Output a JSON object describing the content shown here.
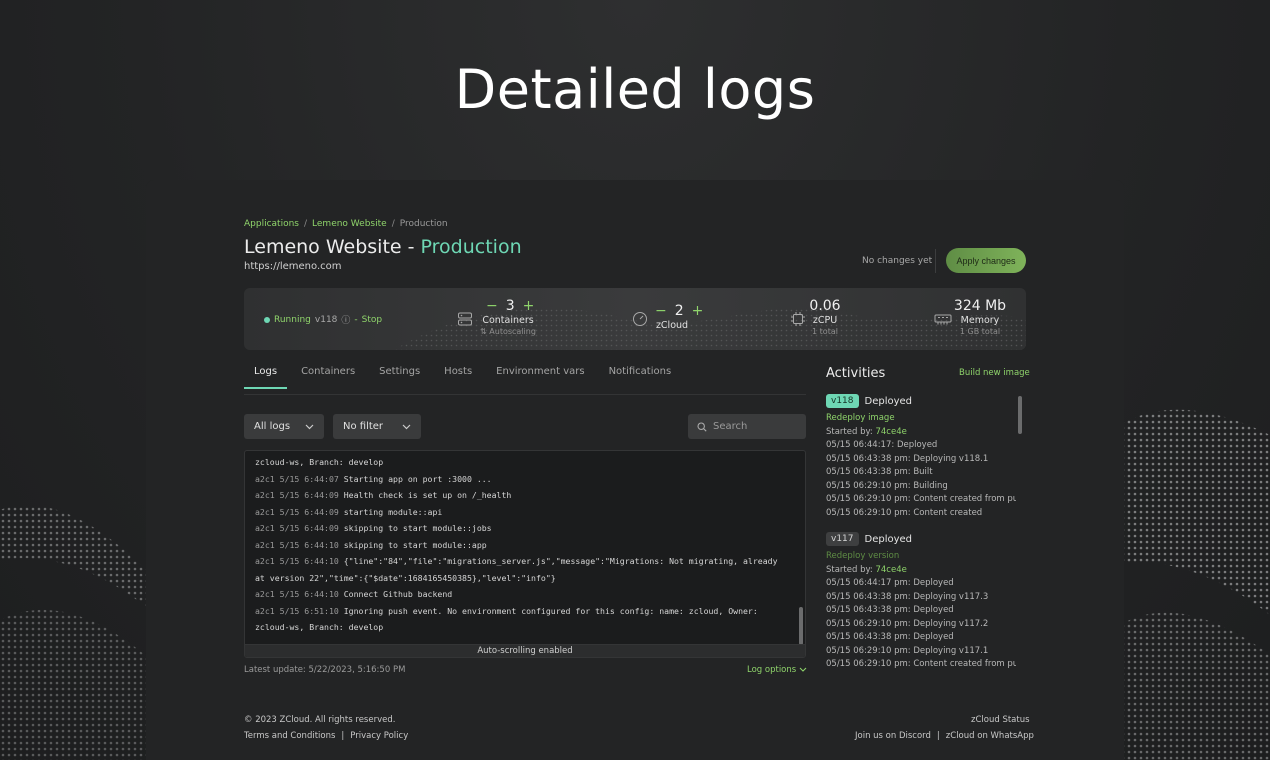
{
  "hero": {
    "title": "Detailed logs"
  },
  "breadcrumb": {
    "items": [
      "Applications",
      "Lemeno Website",
      "Production"
    ]
  },
  "header": {
    "app_name": "Lemeno Website - ",
    "environment": "Production",
    "url": "https://lemeno.com",
    "no_changes": "No changes yet",
    "apply_label": "Apply changes"
  },
  "stats": {
    "status": {
      "state": "Running",
      "version": "v118",
      "separator": "-",
      "action": "Stop"
    },
    "containers": {
      "value": "3",
      "label": "Containers",
      "sub": "⇅ Autoscaling"
    },
    "zcloud": {
      "value": "2",
      "label": "zCloud"
    },
    "zcpu": {
      "value": "0.06",
      "label": "zCPU",
      "sub": "1 total"
    },
    "memory": {
      "value": "324 Mb",
      "label": "Memory",
      "sub": "1 GB total"
    }
  },
  "tabs": [
    "Logs",
    "Containers",
    "Settings",
    "Hosts",
    "Environment vars",
    "Notifications"
  ],
  "filters": {
    "logs": "All logs",
    "filter": "No filter",
    "search_placeholder": "Search"
  },
  "logs": {
    "lines": [
      {
        "meta": "",
        "text": "zcloud-ws, Branch: develop"
      },
      {
        "meta": "a2c1 5/15 6:44:07 ",
        "text": "Starting app on port :3000 ..."
      },
      {
        "meta": "a2c1 5/15 6:44:09 ",
        "text": "Health check is set up on /_health"
      },
      {
        "meta": "a2c1 5/15 6:44:09 ",
        "text": "starting module::api"
      },
      {
        "meta": "a2c1 5/15 6:44:09 ",
        "text": "skipping to start module::jobs"
      },
      {
        "meta": "a2c1 5/15 6:44:10 ",
        "text": "skipping to start module::app"
      },
      {
        "meta": "a2c1 5/15 6:44:10 ",
        "text": "{\"line\":\"84\",\"file\":\"migrations_server.js\",\"message\":\"Migrations: Not migrating, already"
      },
      {
        "meta": "",
        "text": "at version 22\",\"time\":{\"$date\":1684165450385},\"level\":\"info\"}"
      },
      {
        "meta": "a2c1 5/15 6:44:10 ",
        "text": "Connect Github backend"
      },
      {
        "meta": "a2c1 5/15 6:51:10 ",
        "text": "Ignoring push event. No environment configured for this config: name: zcloud, Owner:"
      },
      {
        "meta": "",
        "text": "zcloud-ws, Branch: develop"
      }
    ],
    "autoscroll": "Auto-scrolling enabled",
    "latest_update": "Latest update: 5/22/2023, 5:16:50 PM",
    "options_label": "Log options"
  },
  "activities": {
    "title": "Activities",
    "build_label": "Build new image",
    "items": [
      {
        "version": "v118",
        "status": "Deployed",
        "action": "Redeploy image",
        "started_by": "Started by: ",
        "hash": "74ce4e",
        "events": [
          "05/15 06:44:17: Deployed",
          "05/15 06:43:38 pm: Deploying v118.1",
          "05/15 06:43:38 pm: Built",
          "05/15 06:29:10 pm: Building",
          "05/15 06:29:10 pm: Content created from pus",
          "05/15 06:29:10 pm: Content created"
        ]
      },
      {
        "version": "v117",
        "status": "Deployed",
        "action": "Redeploy version",
        "started_by": "Started by: ",
        "hash": "74ce4e",
        "events": [
          "05/15 06:44:17 pm: Deployed",
          "05/15 06:43:38 pm: Deploying v117.3",
          "05/15 06:43:38 pm: Deployed",
          "05/15 06:29:10 pm: Deploying v117.2",
          "05/15 06:43:38 pm: Deployed",
          "05/15 06:29:10 pm: Deploying v117.1",
          "05/15 06:29:10 pm: Content created from pus"
        ]
      }
    ]
  },
  "footer": {
    "copyright": "© 2023 ZCloud. All rights reserved.",
    "terms": "Terms and Conditions",
    "sep": "|",
    "privacy": "Privacy Policy",
    "status": "zCloud Status",
    "discord": "Join us on Discord",
    "whatsapp": "zCloud on WhatsApp"
  },
  "colors": {
    "accent_green": "#8fd46b",
    "accent_teal": "#6ed7b4",
    "background": "#232425"
  }
}
